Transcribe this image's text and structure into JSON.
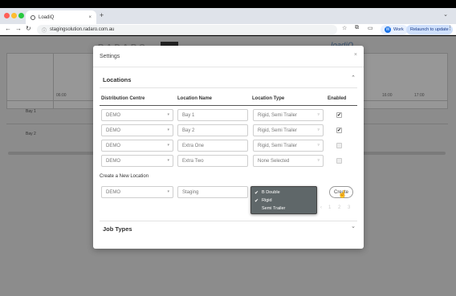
{
  "browser": {
    "tab_title": "LoadiQ",
    "tab_close": "×",
    "new_tab": "+",
    "tab_menu": "⌄",
    "nav_back": "←",
    "nav_forward": "→",
    "nav_reload": "↻",
    "url": "stagingsolution.radaro.com.au",
    "profile_initial": "W",
    "profile_label": "Work",
    "relaunch_label": "Relaunch to update",
    "menu": "⋮"
  },
  "app": {
    "logo_text": "RADARO",
    "brand_text": "loadiQ",
    "time_headers": [
      "06:00",
      "16:00",
      "17:00"
    ],
    "bays": [
      "Bay 1",
      "Bay 2"
    ]
  },
  "modal": {
    "title": "Settings",
    "close": "×",
    "locations_header": "Locations",
    "columns": {
      "distribution_centre": "Distribution Centre",
      "location_name": "Location Name",
      "location_type": "Location Type",
      "enabled": "Enabled"
    },
    "rows": [
      {
        "dc": "DEMO",
        "name": "Bay 1",
        "type": "Rigid, Semi Trailer",
        "enabled": true,
        "check": "✔"
      },
      {
        "dc": "DEMO",
        "name": "Bay 2",
        "type": "Rigid, Semi Trailer",
        "enabled": true,
        "check": "✔"
      },
      {
        "dc": "DEMO",
        "name": "Extra One",
        "type": "Rigid, Semi Trailer",
        "enabled": false,
        "check": ""
      },
      {
        "dc": "DEMO",
        "name": "Extra Two",
        "type": "None Selected",
        "enabled": false,
        "check": ""
      }
    ],
    "create_label": "Create a New Location",
    "new_dc": "DEMO",
    "new_name_placeholder": "Staging",
    "create_button": "Create",
    "pager": [
      "1",
      "2",
      "3"
    ],
    "job_types_header": "Job Types"
  },
  "type_dropdown": {
    "options": [
      {
        "label": "B Double",
        "checked": true,
        "mark": "✔"
      },
      {
        "label": "Rigid",
        "checked": true,
        "mark": "✔"
      },
      {
        "label": "Semi Trailer",
        "checked": false,
        "mark": ""
      }
    ]
  },
  "colors": {
    "overlay": "#8c8c8c",
    "popup_bg": "#5f6769",
    "link_blue": "#1a73e8"
  }
}
